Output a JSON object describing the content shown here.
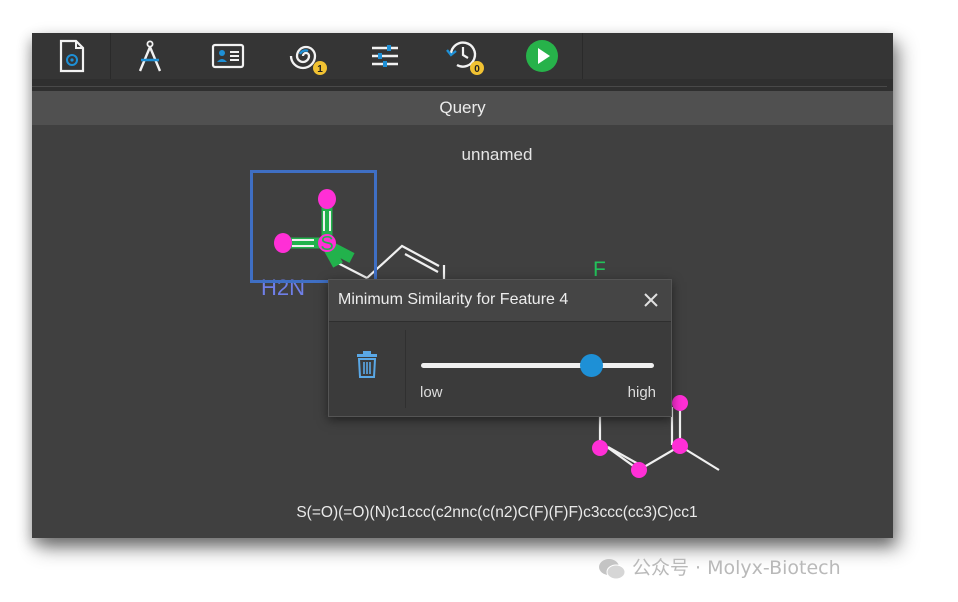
{
  "toolbar": {
    "buttons": [
      {
        "name": "document-icon"
      },
      {
        "name": "drawing-compass-icon"
      },
      {
        "name": "id-card-icon"
      },
      {
        "name": "similarity-spiral-icon",
        "badge": "1"
      },
      {
        "name": "sliders-icon"
      },
      {
        "name": "history-icon",
        "badge": "0"
      },
      {
        "name": "run-icon"
      }
    ]
  },
  "query_bar": {
    "title": "Query"
  },
  "molecule": {
    "name": "unnamed",
    "smiles": "S(=O)(=O)(N)c1ccc(c2nnc(c(n2)C(F)(F)F)c3ccc(cc3)C)cc1",
    "labels": {
      "sulfur": "S",
      "amine": "H2N",
      "fluorine": "F"
    }
  },
  "dialog": {
    "title": "Minimum Similarity for Feature 4",
    "slider": {
      "low_label": "low",
      "high_label": "high",
      "value": 0.73
    }
  },
  "watermark": {
    "text": "公众号 · Molyx-Biotech"
  },
  "colors": {
    "highlight_green": "#22b24c",
    "atom_magenta": "#ff2fd6",
    "accent_blue": "#1e90d6",
    "run_green": "#27b24a",
    "badge_yellow": "#f1c232"
  }
}
